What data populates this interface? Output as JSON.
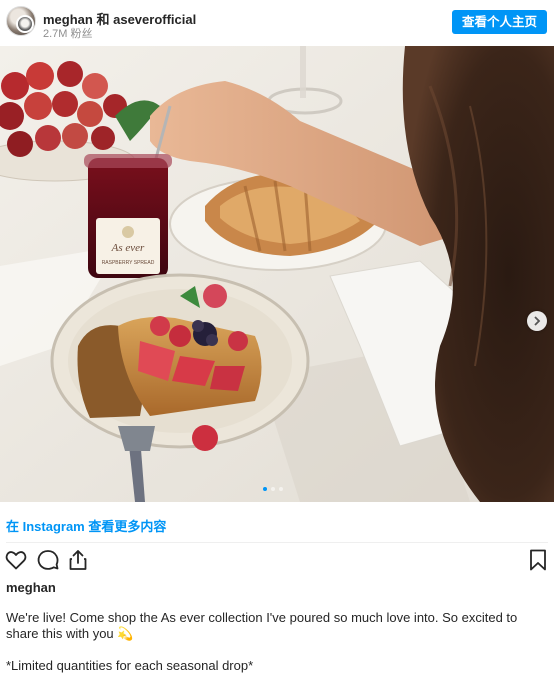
{
  "header": {
    "username": "meghan",
    "joiner": "和",
    "collaborator": "aseverofficial",
    "followers": "2.7M 粉丝",
    "profile_button": "查看个人主页"
  },
  "photo": {
    "alt_content": "breakfast table with toast, berries, jam jar and croissant",
    "jar_label_brand": "As ever",
    "jar_label_sub": "RASPBERRY SPREAD",
    "carousel": {
      "count": 3,
      "active": 1
    }
  },
  "link": {
    "text": "在 Instagram 查看更多内容"
  },
  "actions": {
    "icons": [
      "heart-icon",
      "comment-icon",
      "share-icon",
      "bookmark-icon"
    ]
  },
  "post": {
    "author": "meghan",
    "caption": "We're live! Come shop the As ever collection I've poured so much love into. So excited to share this with you",
    "caption_emoji": "💫",
    "caption_note": "*Limited quantities for each seasonal drop*"
  },
  "colors": {
    "accent": "#0095f6",
    "text": "#262626",
    "muted": "#8e8e8e"
  }
}
